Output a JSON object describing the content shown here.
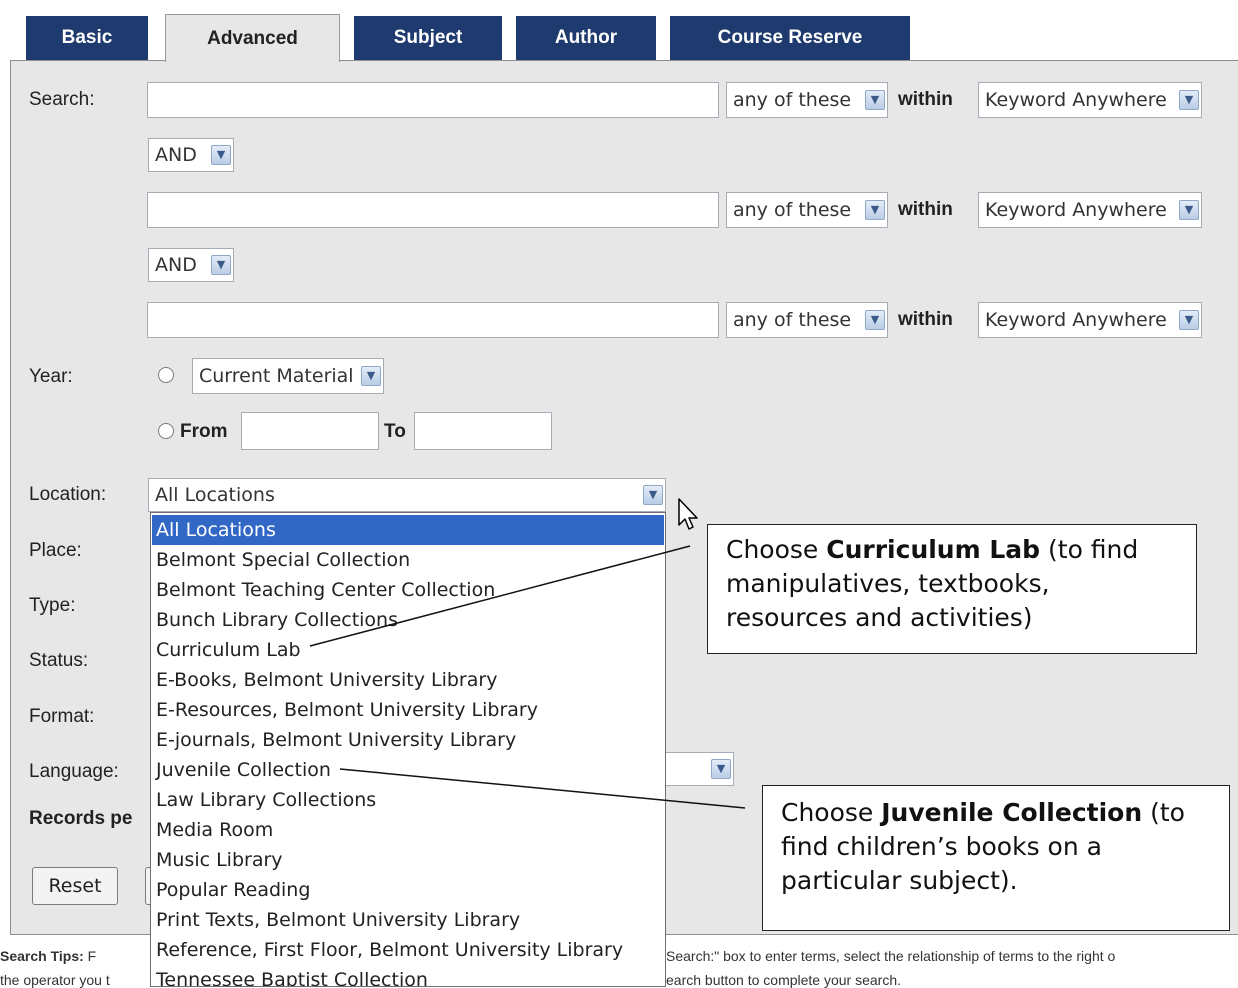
{
  "tabs": [
    {
      "label": "Basic"
    },
    {
      "label": "Advanced"
    },
    {
      "label": "Subject"
    },
    {
      "label": "Author"
    },
    {
      "label": "Course Reserve"
    }
  ],
  "search": {
    "label": "Search:",
    "rows": [
      {
        "match": "any of these",
        "within_label": "within",
        "field": "Keyword Anywhere"
      },
      {
        "match": "any of these",
        "within_label": "within",
        "field": "Keyword Anywhere"
      },
      {
        "match": "any of these",
        "within_label": "within",
        "field": "Keyword Anywhere"
      }
    ],
    "operators": [
      "AND",
      "AND"
    ]
  },
  "year": {
    "label": "Year:",
    "preset": "Current Material",
    "from_label": "From",
    "to_label": "To"
  },
  "labels": {
    "location": "Location:",
    "place": "Place:",
    "type": "Type:",
    "status": "Status:",
    "format": "Format:",
    "language": "Language:",
    "records": "Records pe"
  },
  "location": {
    "selected": "All Locations",
    "options": [
      "All Locations",
      "Belmont Special Collection",
      "Belmont Teaching Center Collection",
      "Bunch Library Collections",
      "Curriculum Lab",
      "E-Books, Belmont University Library",
      "E-Resources, Belmont University Library",
      "E-journals, Belmont University Library",
      "Juvenile Collection",
      "Law Library Collections",
      "Media Room",
      "Music Library",
      "Popular Reading",
      "Print Texts, Belmont University Library",
      "Reference, First Floor, Belmont University Library",
      "Tennessee Baptist Collection"
    ]
  },
  "buttons": {
    "reset": "Reset"
  },
  "tips": {
    "bold": "Search Tips:",
    "line1_left": "F",
    "line1_right": "Search:\" box to enter terms, select the relationship of terms to the right o",
    "line2_left": "the operator you t",
    "line2_right": "earch button to complete your search."
  },
  "callouts": {
    "curriculum": {
      "pre": "Choose ",
      "bold": "Curriculum Lab",
      "post": " (to find manipulatives, textbooks, resources and activities)"
    },
    "juvenile": {
      "pre": "Choose ",
      "bold": "Juvenile Collection",
      "post": " (to find children’s books on a particular subject)."
    }
  }
}
